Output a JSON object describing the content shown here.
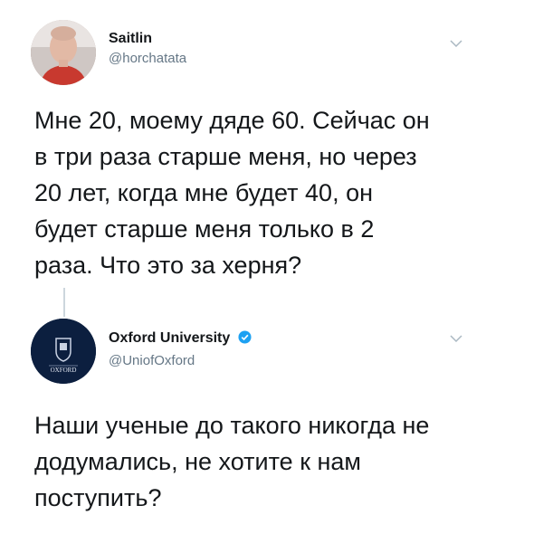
{
  "tweets": [
    {
      "name": "Saitlin",
      "handle": "@horchatata",
      "text_lines": [
        "Мне 20, моему дяде 60. Сейчас он",
        "в три раза старше меня, но через",
        "20 лет, когда мне будет 40, он",
        "будет старше меня только в 2",
        "раза. Что это за херня?"
      ],
      "verified": false,
      "avatar": "profile-photo"
    },
    {
      "name": "Oxford University",
      "handle": "@UniofOxford",
      "text_lines": [
        "Наши ученые до такого никогда не",
        "додумались, не хотите к нам",
        "поступить?"
      ],
      "verified": true,
      "avatar": "oxford-crest-logo",
      "avatar_logo_text": "OXFORD"
    }
  ],
  "icons": {
    "menu": "chevron-down-icon",
    "verified": "verified-badge-icon"
  },
  "colors": {
    "text": "#14171a",
    "secondary": "#657786",
    "verified": "#1da1f2",
    "oxford_blue": "#0c1f3f",
    "thread_line": "#ccd6dd"
  }
}
